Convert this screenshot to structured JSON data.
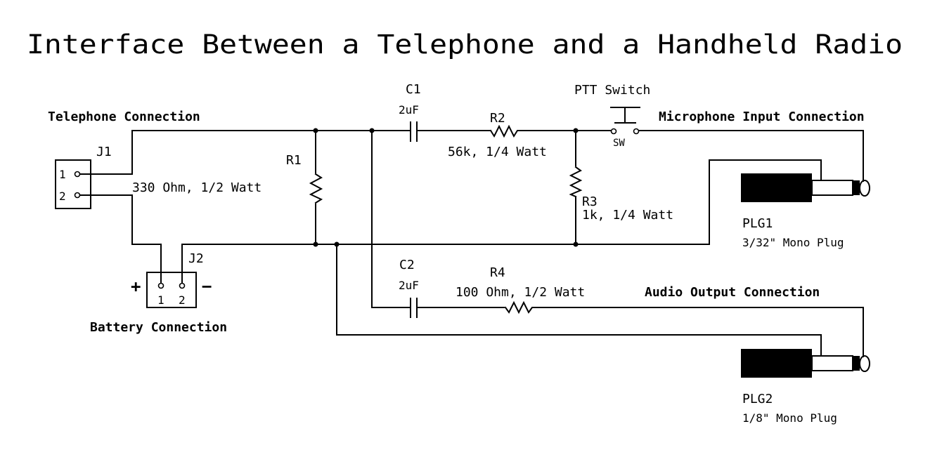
{
  "title": "Interface Between a Telephone and a Handheld Radio",
  "sections": {
    "telephone": "Telephone Connection",
    "battery": "Battery Connection",
    "microphone": "Microphone Input Connection",
    "audio_out": "Audio Output Connection"
  },
  "components": {
    "J1": {
      "ref": "J1",
      "pins": [
        "1",
        "2"
      ]
    },
    "J2": {
      "ref": "J2",
      "pins": [
        "1",
        "2"
      ],
      "plus": "+",
      "minus": "−"
    },
    "R1": {
      "ref": "R1",
      "value": "330 Ohm, 1/2 Watt"
    },
    "R2": {
      "ref": "R2",
      "value": "56k, 1/4 Watt"
    },
    "R3": {
      "ref": "R3",
      "value": "1k, 1/4 Watt"
    },
    "R4": {
      "ref": "R4",
      "value": "100 Ohm, 1/2 Watt"
    },
    "C1": {
      "ref": "C1",
      "value": "2uF"
    },
    "C2": {
      "ref": "C2",
      "value": "2uF"
    },
    "SW": {
      "name": "PTT Switch",
      "ref": "SW"
    },
    "PLG1": {
      "ref": "PLG1",
      "desc": "3/32\" Mono Plug"
    },
    "PLG2": {
      "ref": "PLG2",
      "desc": "1/8\" Mono Plug"
    }
  }
}
